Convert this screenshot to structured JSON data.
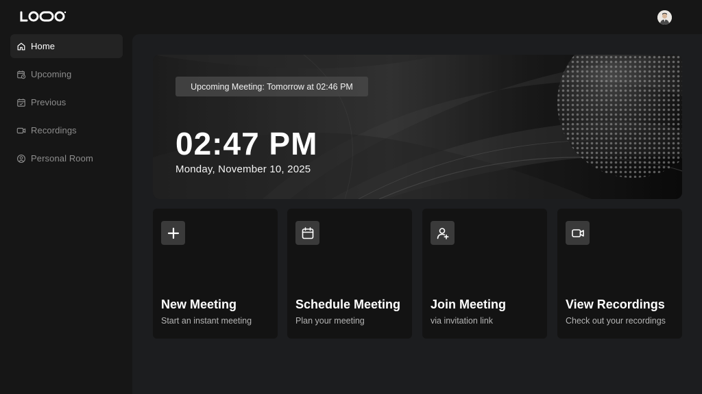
{
  "header": {
    "logo_text": "LOOO",
    "avatar_icon": "user-avatar"
  },
  "sidebar": {
    "items": [
      {
        "label": "Home",
        "icon": "home-icon",
        "active": true
      },
      {
        "label": "Upcoming",
        "icon": "calendar-clock-icon",
        "active": false
      },
      {
        "label": "Previous",
        "icon": "calendar-check-icon",
        "active": false
      },
      {
        "label": "Recordings",
        "icon": "video-icon",
        "active": false
      },
      {
        "label": "Personal Room",
        "icon": "user-circle-icon",
        "active": false
      }
    ]
  },
  "hero": {
    "upcoming": "Upcoming Meeting: Tomorrow at 02:46 PM",
    "time": "02:47 PM",
    "date": "Monday, November 10, 2025"
  },
  "cards": [
    {
      "title": "New Meeting",
      "subtitle": "Start an instant meeting",
      "icon": "plus-icon"
    },
    {
      "title": "Schedule Meeting",
      "subtitle": "Plan your meeting",
      "icon": "calendar-icon"
    },
    {
      "title": "Join Meeting",
      "subtitle": "via invitation link",
      "icon": "user-add-icon"
    },
    {
      "title": "View Recordings",
      "subtitle": "Check out your recordings",
      "icon": "video-icon"
    }
  ],
  "colors": {
    "background": "#161616",
    "main": "#1c1d1f",
    "card": "#131313",
    "active_nav": "#232323",
    "text_muted": "#8d8d8d"
  }
}
